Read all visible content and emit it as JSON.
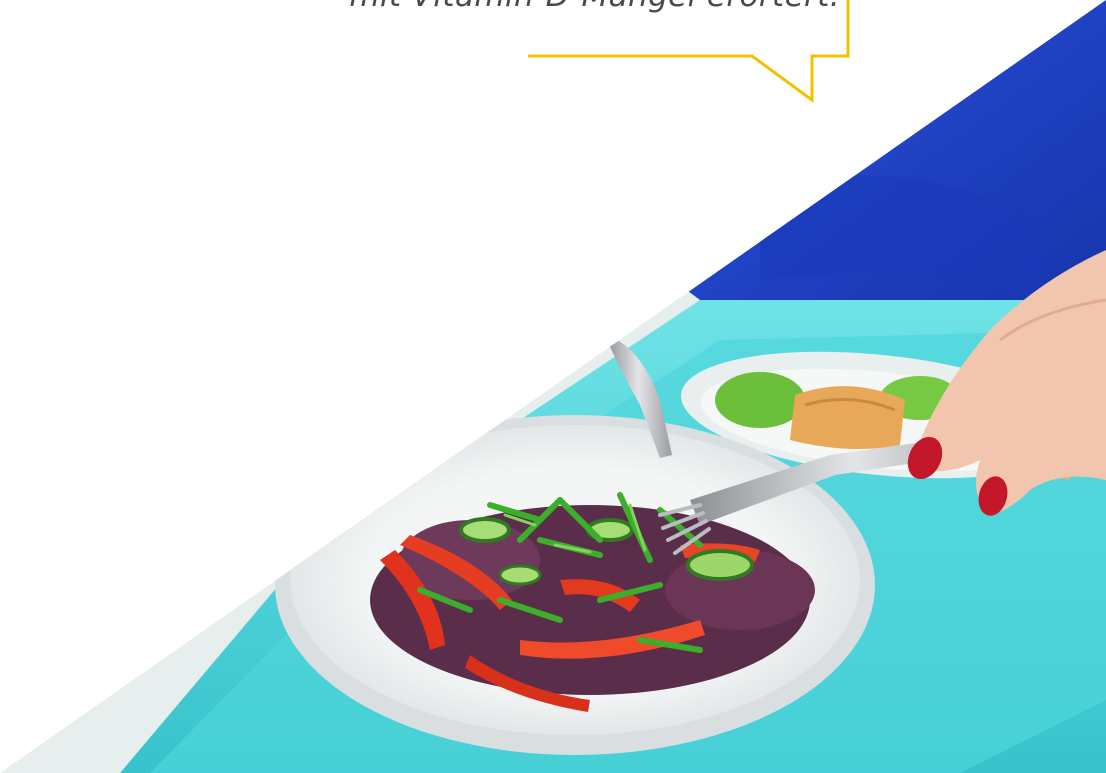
{
  "quote": {
    "text": "mit Vitamin-D-Mangel erörtert."
  },
  "colors": {
    "callout_border": "#f2c200",
    "background": "#ffffff",
    "blue_uniform": "#1a3fc4",
    "tray_turquoise": "#4fd6dc",
    "text": "#4a4a4a"
  },
  "photo": {
    "subject": "hospital meal tray with fresh salad, fork and knife"
  }
}
